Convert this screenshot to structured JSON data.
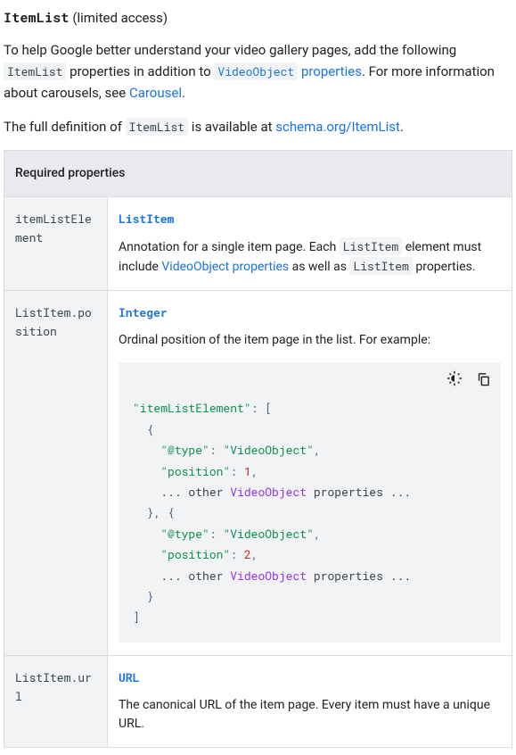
{
  "header": {
    "code": "ItemList",
    "suffix": " (limited access)"
  },
  "intro": {
    "p1_pre": "To help Google better understand your video gallery pages, add the following ",
    "p1_code": "ItemList",
    "p1_mid": " properties in addition to ",
    "p1_link_code": "VideoObject",
    "p1_link_rest": " properties",
    "p1_after": ". For more information about carousels, see ",
    "p1_link2": "Carousel",
    "p1_end": ".",
    "p2_pre": "The full definition of ",
    "p2_code": "ItemList",
    "p2_mid": " is available at ",
    "p2_link": "schema.org/ItemList",
    "p2_end": "."
  },
  "table": {
    "header": "Required properties",
    "rows": [
      {
        "name": "itemListElement",
        "type": "ListItem",
        "desc_pre": "Annotation for a single item page. Each ",
        "desc_code1": "ListItem",
        "desc_mid": " element must include ",
        "desc_link": "VideoObject properties",
        "desc_after": " as well as ",
        "desc_code2": "ListItem",
        "desc_end": " properties."
      },
      {
        "name": "ListItem.position",
        "type": "Integer",
        "desc": "Ordinal position of the item page in the list. For example:"
      },
      {
        "name": "ListItem.url",
        "type": "URL",
        "desc": "The canonical URL of the item page. Every item must have a unique URL."
      }
    ]
  },
  "code": {
    "key_itemListElement": "\"itemListElement\"",
    "key_type": "\"@type\"",
    "val_vo": "\"VideoObject\"",
    "key_position": "\"position\"",
    "num1": "1",
    "num2": "2",
    "other_pre": "... other ",
    "other_mid": "VideoObject",
    "other_post": " properties ..."
  }
}
